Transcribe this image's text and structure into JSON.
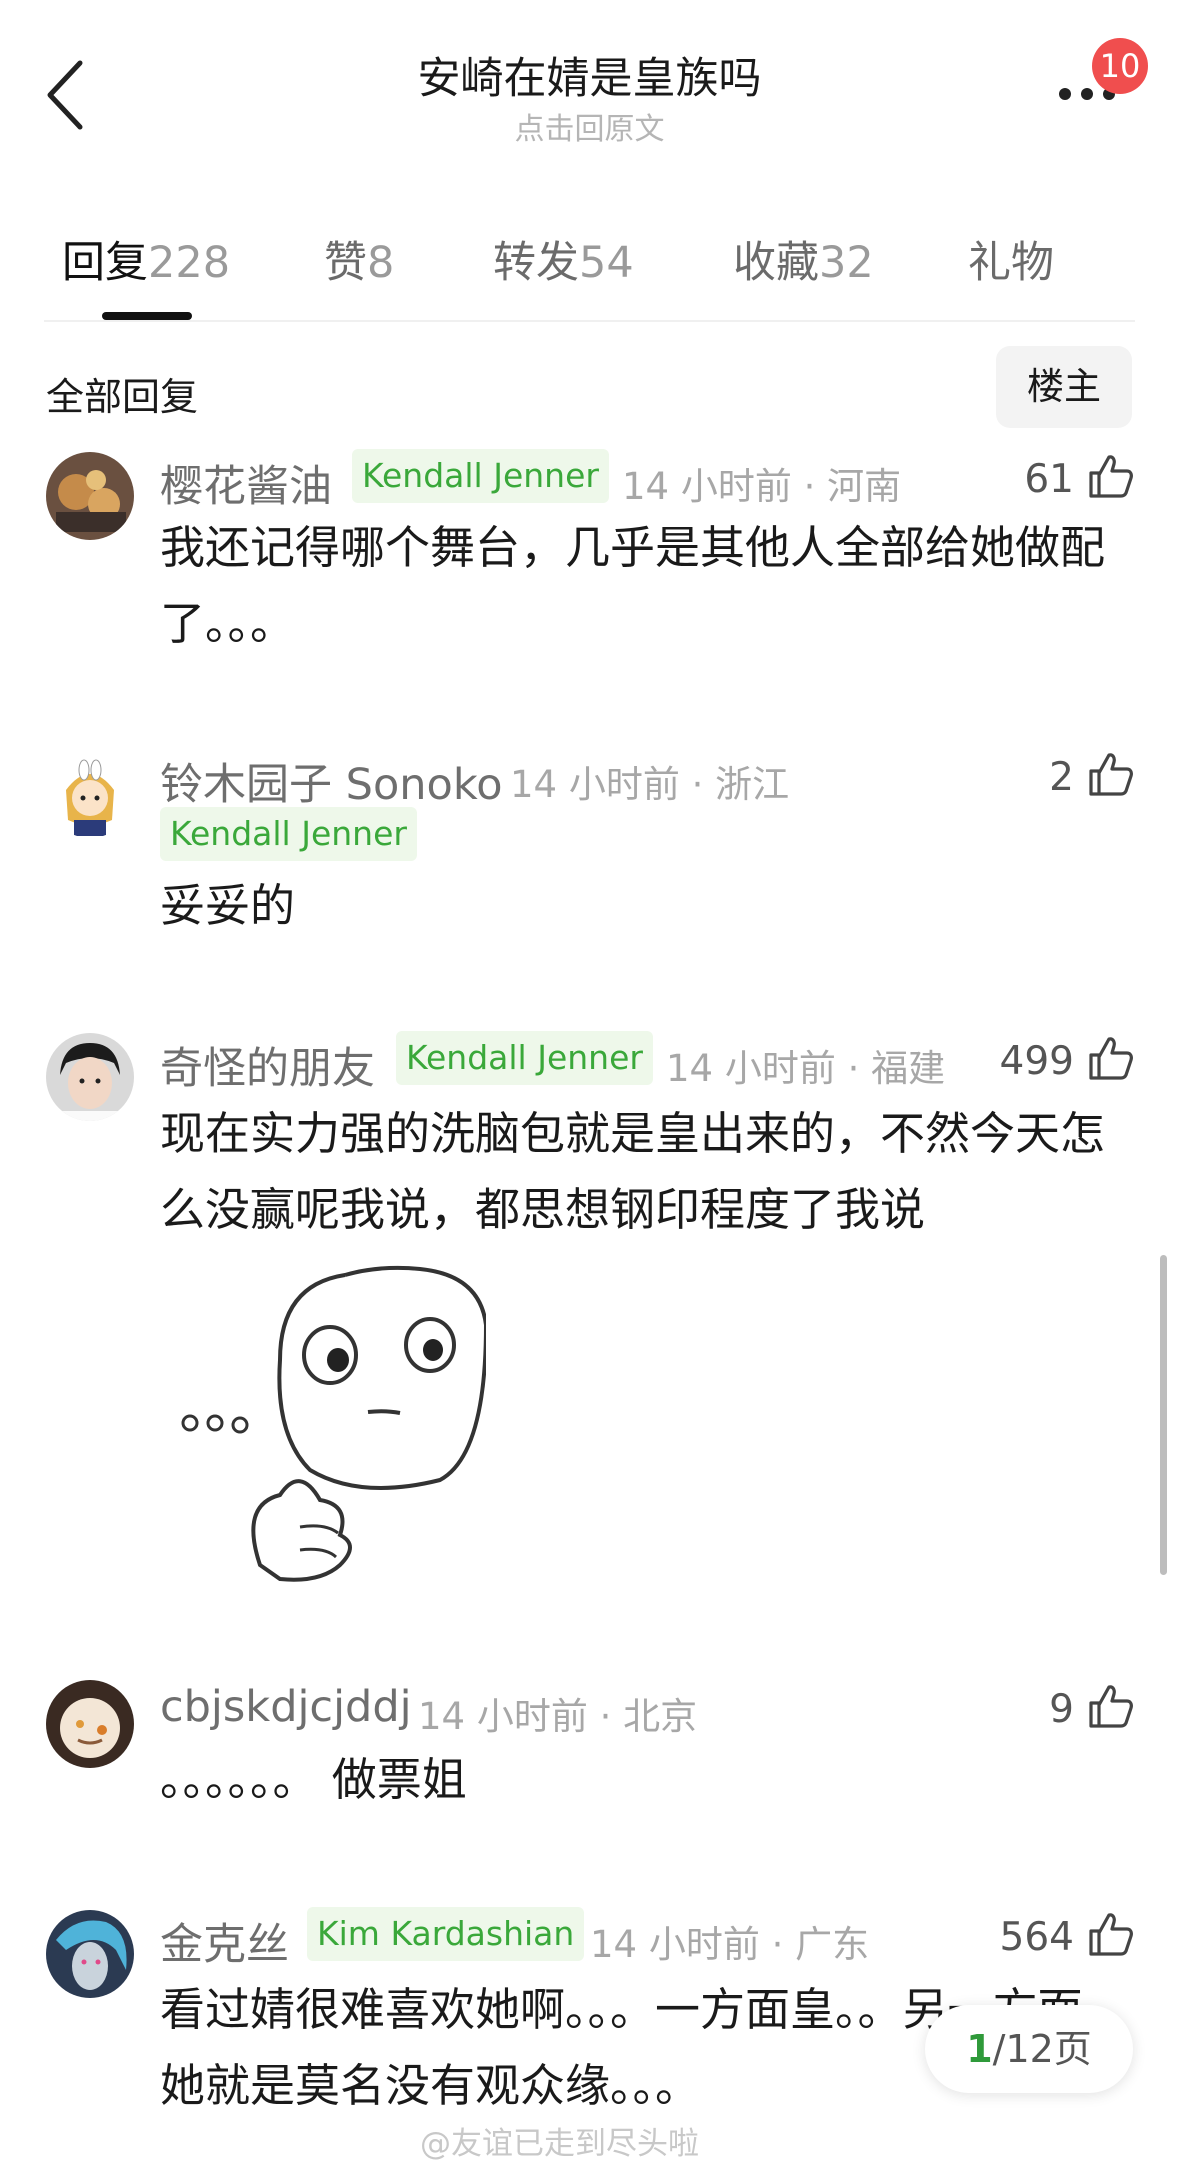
{
  "header": {
    "title": "安崎在婧是皇族吗",
    "subtitle": "点击回原文",
    "badge_count": "10"
  },
  "tabs": [
    {
      "label": "回复",
      "count": "228",
      "active": true
    },
    {
      "label": "赞",
      "count": "8"
    },
    {
      "label": "转发",
      "count": "54"
    },
    {
      "label": "收藏",
      "count": "32"
    },
    {
      "label": "礼物",
      "count": ""
    }
  ],
  "section": {
    "title": "全部回复",
    "op_button": "楼主"
  },
  "comments": [
    {
      "user": "樱花酱油",
      "tag": "Kendall Jenner",
      "meta": "14 小时前 · 河南",
      "likes": "61",
      "text": "我还记得哪个舞台，几乎是其他人全部给她做配了。。。"
    },
    {
      "user": "铃木园子 Sonoko",
      "tag": "Kendall Jenner",
      "meta": "14 小时前 · 浙江",
      "likes": "2",
      "text": "妥妥的"
    },
    {
      "user": "奇怪的朋友",
      "tag": "Kendall Jenner",
      "meta": "14 小时前 · 福建",
      "likes": "499",
      "text": "现在实力强的洗脑包就是皇出来的，不然今天怎么没赢呢我说，都思想钢印程度了我说"
    },
    {
      "user": "cbjskdjcjddj",
      "tag": "",
      "meta": "14 小时前 · 北京",
      "likes": "9",
      "text": "。。。。。。 做票姐"
    },
    {
      "user": "金克丝",
      "tag": "Kim Kardashian",
      "meta": "14 小时前 · 广东",
      "likes": "564",
      "text": "看过婧很难喜欢她啊。。。一方面皇。。另一方面她就是莫名没有观众缘。。。"
    }
  ],
  "pager": {
    "current": "1",
    "total": "/12页"
  },
  "watermark": "@友谊已走到尽头啦",
  "colors": {
    "tag_green": "#3aa83a",
    "badge_red": "#f04e4e",
    "pager_green": "#2f9a3a"
  }
}
